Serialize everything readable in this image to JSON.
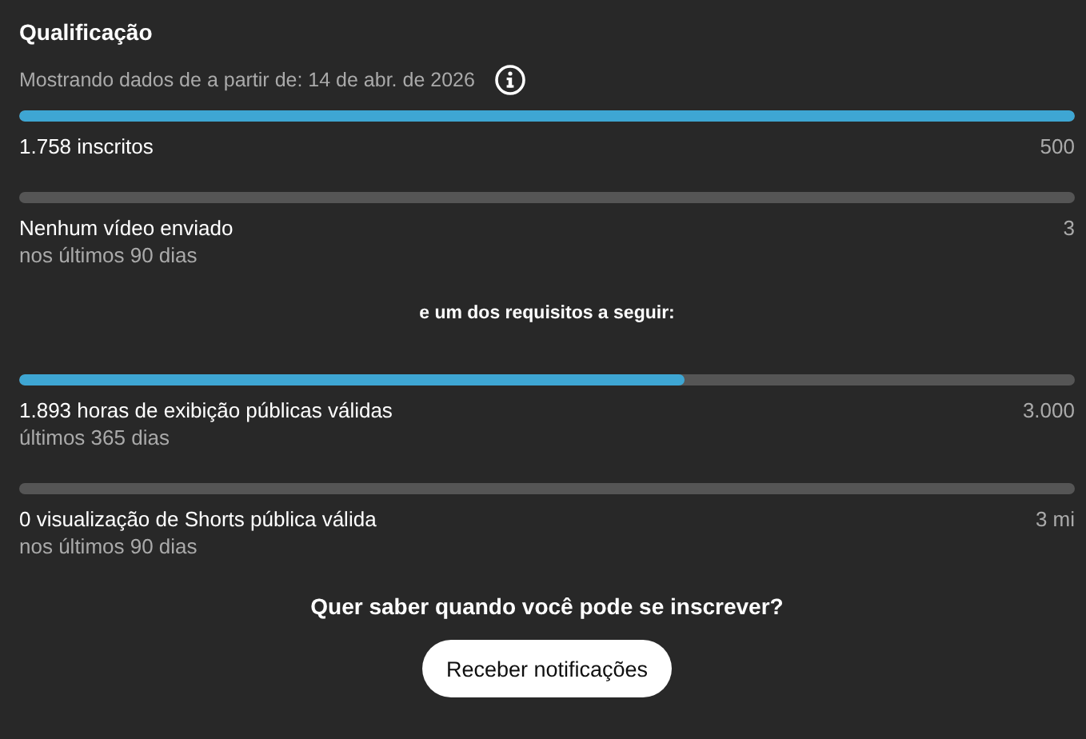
{
  "title": "Qualificação",
  "date_note": "Mostrando dados de a partir de: 14 de abr. de 2026",
  "requirements": [
    {
      "label": "1.758 inscritos",
      "target": "500",
      "level": 1
    },
    {
      "label": "Nenhum vídeo enviado",
      "sublabel": "nos últimos 90 dias",
      "target": "3",
      "level": 0
    }
  ],
  "alternative_label": "e um dos requisitos a seguir:",
  "alternatives": [
    {
      "label": "1.893 horas de exibição públicas válidas",
      "sublabel": "últimos 365 dias",
      "target": "3.000",
      "level": 0.631
    },
    {
      "label": "0 visualização de Shorts pública válida",
      "sublabel": "nos últimos 90 dias",
      "target": "3 mi",
      "level": 0
    }
  ],
  "question": "Quer saber quando você pode se inscrever?",
  "button": "Receber notificações"
}
